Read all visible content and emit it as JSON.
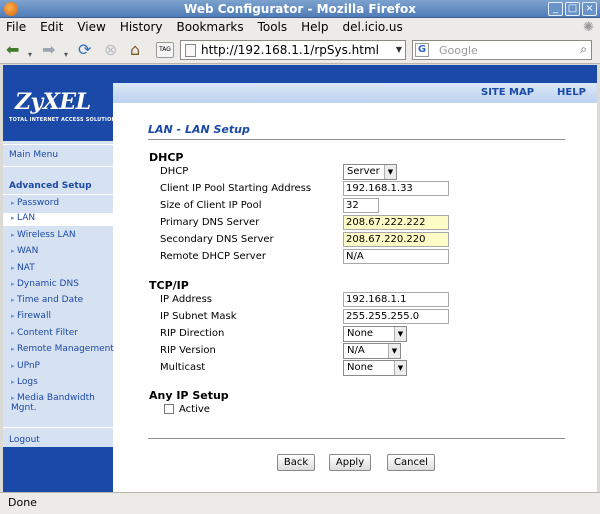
{
  "window": {
    "title": "Web Configurator - Mozilla Firefox"
  },
  "menu": [
    "File",
    "Edit",
    "View",
    "History",
    "Bookmarks",
    "Tools",
    "Help",
    "del.icio.us"
  ],
  "toolbar": {
    "url": "http://192.168.1.1/rpSys.html",
    "search_placeholder": "Google",
    "tag_label": "TAG"
  },
  "header": {
    "logo": "ZyXEL",
    "logo_tagline": "TOTAL INTERNET ACCESS SOLUTION",
    "links": [
      "SITE MAP",
      "HELP"
    ]
  },
  "sidebar": {
    "main_menu": "Main Menu",
    "advanced_setup": "Advanced Setup",
    "items": [
      "Password",
      "LAN",
      "Wireless LAN",
      "WAN",
      "NAT",
      "Dynamic DNS",
      "Time and Date",
      "Firewall",
      "Content Filter",
      "Remote Management",
      "UPnP",
      "Logs",
      "Media Bandwidth Mgnt."
    ],
    "logout": "Logout"
  },
  "page": {
    "heading": "LAN - LAN Setup",
    "dhcp_section": "DHCP",
    "dhcp": {
      "dhcp_label": "DHCP",
      "dhcp_value": "Server",
      "pool_start_label": "Client IP Pool Starting Address",
      "pool_start_value": "192.168.1.33",
      "pool_size_label": "Size of Client IP Pool",
      "pool_size_value": "32",
      "primary_dns_label": "Primary DNS Server",
      "primary_dns_value": "208.67.222.222",
      "secondary_dns_label": "Secondary DNS Server",
      "secondary_dns_value": "208.67.220.220",
      "remote_dhcp_label": "Remote DHCP Server",
      "remote_dhcp_value": "N/A"
    },
    "tcpip_section": "TCP/IP",
    "tcpip": {
      "ip_label": "IP Address",
      "ip_value": "192.168.1.1",
      "mask_label": "IP Subnet Mask",
      "mask_value": "255.255.255.0",
      "rip_dir_label": "RIP Direction",
      "rip_dir_value": "None",
      "rip_ver_label": "RIP Version",
      "rip_ver_value": "N/A",
      "multicast_label": "Multicast",
      "multicast_value": "None"
    },
    "any_ip_section": "Any IP Setup",
    "active_label": "Active",
    "buttons": {
      "back": "Back",
      "apply": "Apply",
      "cancel": "Cancel"
    }
  },
  "status": "Done"
}
